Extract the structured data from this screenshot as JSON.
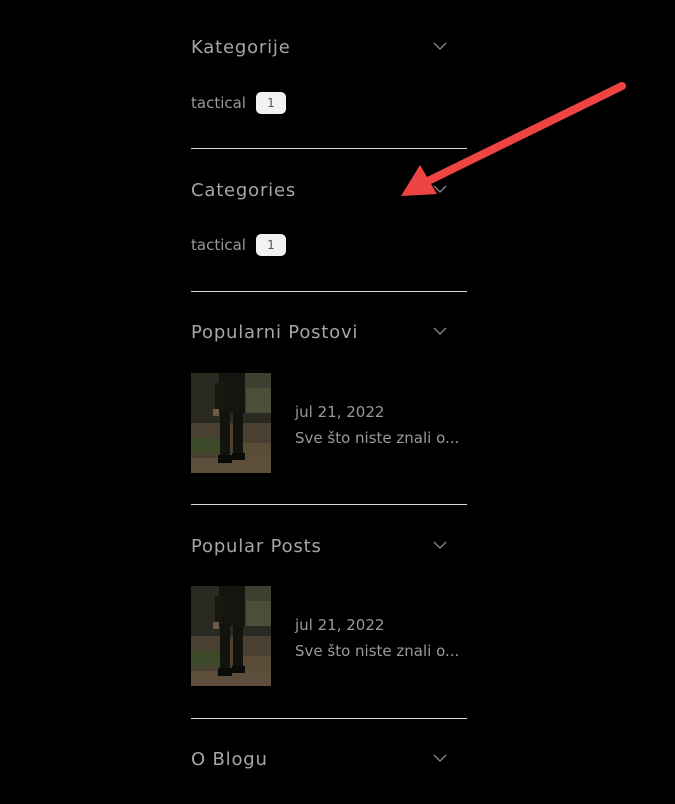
{
  "colors": {
    "background": "#000000",
    "text": "#9a9a9a",
    "divider": "#d9d9d9",
    "badge": "#f2f2f2",
    "arrow": "#ef4444"
  },
  "widgets": {
    "kategorije": {
      "title": "Kategorije",
      "icon": "chevron-down-icon",
      "items": [
        {
          "name": "tactical",
          "count": "1"
        }
      ]
    },
    "categories": {
      "title": "Categories",
      "icon": "chevron-down-icon",
      "items": [
        {
          "name": "tactical",
          "count": "1"
        }
      ]
    },
    "popularni_postovi": {
      "title": "Popularni Postovi",
      "icon": "chevron-down-icon",
      "posts": [
        {
          "date": "jul 21, 2022",
          "title": "Sve što niste znali o..."
        }
      ]
    },
    "popular_posts": {
      "title": "Popular Posts",
      "icon": "chevron-down-icon",
      "posts": [
        {
          "date": "jul 21, 2022",
          "title": "Sve što niste znali o..."
        }
      ]
    },
    "o_blogu": {
      "title": "O Blogu",
      "icon": "chevron-down-icon"
    }
  },
  "annotation": {
    "icon": "red-arrow-icon",
    "points_to": "categories chevron"
  }
}
